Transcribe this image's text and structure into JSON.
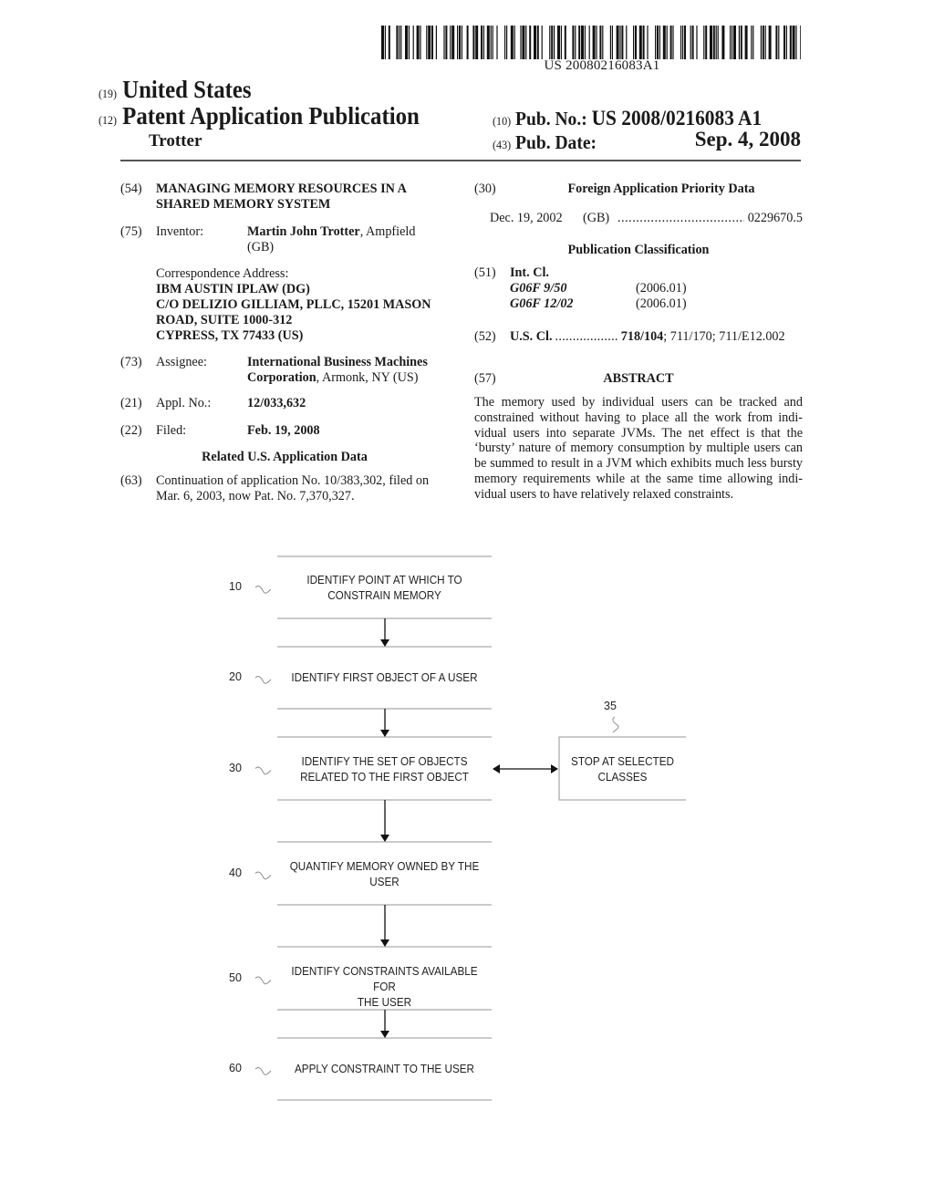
{
  "header": {
    "barcode_text": "US 20080216083A1",
    "country_code": "(19)",
    "country": "United States",
    "doc_type_code": "(12)",
    "doc_type": "Patent Application Publication",
    "author": "Trotter",
    "pub_no_code": "(10)",
    "pub_no_label": "Pub. No.:",
    "pub_no": "US 2008/0216083 A1",
    "pub_date_code": "(43)",
    "pub_date_label": "Pub. Date:",
    "pub_date": "Sep. 4, 2008"
  },
  "biblio": {
    "title_code": "(54)",
    "title_line1": "MANAGING MEMORY RESOURCES IN A",
    "title_line2": "SHARED MEMORY SYSTEM",
    "inventor_code": "(75)",
    "inventor_label": "Inventor:",
    "inventor_name": "Martin John Trotter",
    "inventor_loc1": ", Ampfield",
    "inventor_loc2": "(GB)",
    "correspondence_label": "Correspondence Address:",
    "correspondence_lines": [
      "IBM AUSTIN IPLAW (DG)",
      "C/O DELIZIO GILLIAM, PLLC, 15201 MASON",
      "ROAD, SUITE 1000-312",
      "CYPRESS, TX 77433 (US)"
    ],
    "assignee_code": "(73)",
    "assignee_label": "Assignee:",
    "assignee_name1": "International Business Machines",
    "assignee_name2": "Corporation",
    "assignee_loc": ", Armonk, NY (US)",
    "appl_code": "(21)",
    "appl_label": "Appl. No.:",
    "appl_no": "12/033,632",
    "filed_code": "(22)",
    "filed_label": "Filed:",
    "filed_date": "Feb. 19, 2008",
    "related_heading": "Related U.S. Application Data",
    "continuation_code": "(63)",
    "continuation_line1": "Continuation of application No. 10/383,302, filed on",
    "continuation_line2": "Mar. 6, 2003, now Pat. No. 7,370,327."
  },
  "right": {
    "foreign_code": "(30)",
    "foreign_heading": "Foreign Application Priority Data",
    "priority_date": "Dec. 19, 2002",
    "priority_country": "(GB)",
    "priority_dots": "...................................",
    "priority_number": "0229670.5",
    "pubclass_heading": "Publication Classification",
    "intcl_code": "(51)",
    "intcl_label": "Int. Cl.",
    "intcl": [
      {
        "class": "G06F 9/50",
        "version": "(2006.01)"
      },
      {
        "class": "G06F 12/02",
        "version": "(2006.01)"
      }
    ],
    "uscl_code": "(52)",
    "uscl_label": "U.S. Cl.",
    "uscl_dots": "..................",
    "uscl_primary": "718/104",
    "uscl_rest": "; 711/170; 711/E12.002",
    "abstract_code": "(57)",
    "abstract_heading": "ABSTRACT",
    "abstract_text": "The memory used by individual users can be tracked and constrained without having to place all the work from indi-vidual users into separate JVMs. The net effect is that the ‘bursty’ nature of memory consumption by multiple users can be summed to result in a JVM which exhibits much less bursty memory requirements while at the same time allowing indi-vidual users to have relatively relaxed constraints."
  },
  "flowchart": {
    "steps": [
      {
        "ref": "10",
        "line1": "IDENTIFY POINT AT WHICH TO",
        "line2": "CONSTRAIN MEMORY"
      },
      {
        "ref": "20",
        "line1": "IDENTIFY FIRST OBJECT OF A USER",
        "line2": ""
      },
      {
        "ref": "30",
        "line1": "IDENTIFY THE SET OF OBJECTS",
        "line2": "RELATED TO THE FIRST OBJECT"
      },
      {
        "ref": "40",
        "line1": "QUANTIFY MEMORY OWNED BY THE",
        "line2": "USER"
      },
      {
        "ref": "50",
        "line1": "IDENTIFY CONSTRAINTS AVAILABLE FOR",
        "line2": "THE USER"
      },
      {
        "ref": "60",
        "line1": "APPLY CONSTRAINT TO THE USER",
        "line2": ""
      }
    ],
    "side_box": {
      "ref": "35",
      "line1": "STOP AT SELECTED",
      "line2": "CLASSES"
    }
  }
}
